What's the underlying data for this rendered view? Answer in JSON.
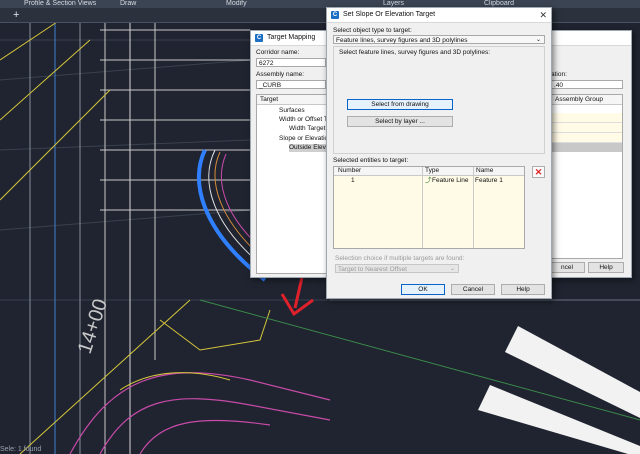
{
  "ribbon": {
    "tabs": [
      "Profile & Section Views",
      "Draw",
      "Modify",
      "Layers",
      "Clipboard"
    ]
  },
  "tab_plus": "+",
  "status_text": "Sele: 1 found",
  "cad": {
    "station_label": "14+00"
  },
  "target_mapping": {
    "title": "Target Mapping",
    "corridor_name_label": "Corridor name:",
    "corridor_name_value": "6272",
    "assembly_name_label": "Assembly name:",
    "assembly_name_value": "_CURB",
    "target_column": "Target",
    "tree": [
      "Surfaces",
      "Width or Offset T",
      "Width Target",
      "Slope or Elevation",
      "Outside Eleva"
    ],
    "right_label_1": "ation:",
    "right_value_1": ".40",
    "assembly_group_label": "Assembly Group",
    "cancel_label": "ncel",
    "help_label": "Help"
  },
  "slope_dialog": {
    "title": "Set Slope Or Elevation Target",
    "close": "✕",
    "select_type_label": "Select object type to target:",
    "select_type_value": "Feature lines, survey figures and 3D polylines",
    "select_features_label": "Select feature lines, survey figures and 3D polylines:",
    "select_from_drawing": "Select from drawing",
    "select_by_layer": "Select by layer ...",
    "selected_entities_label": "Selected entities to target:",
    "columns": [
      "Number",
      "Type",
      "Name"
    ],
    "rows": [
      {
        "number": "1",
        "type": "Feature Line",
        "name": "Feature 1"
      }
    ],
    "selection_choice_label": "Selection choice if multiple targets are found:",
    "selection_choice_value": "Target to Nearest Offset",
    "ok": "OK",
    "cancel": "Cancel",
    "help": "Help"
  },
  "colors": {
    "cad_background": "#1f2430",
    "arrow_red": "#e0202a",
    "highlight_blue": "#2f7fff"
  }
}
